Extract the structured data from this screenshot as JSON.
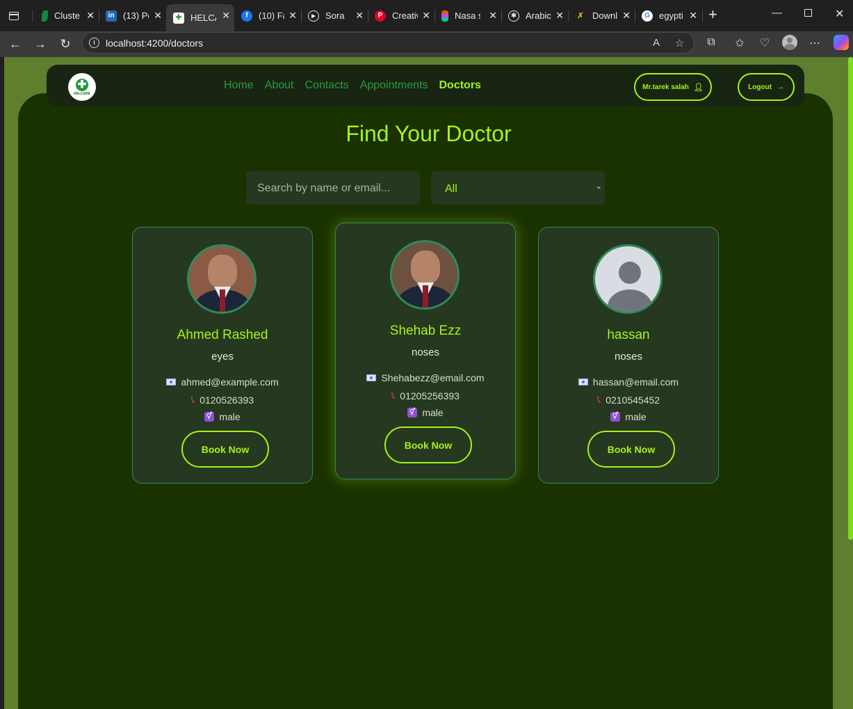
{
  "browser": {
    "tabs": [
      {
        "title": "Cluster",
        "favicon": "mongodb-leaf-icon",
        "color": "#0f8a3c"
      },
      {
        "title": "(13) Po",
        "favicon": "linkedin-icon",
        "color": "#2867b2"
      },
      {
        "title": "HELCA",
        "favicon": "helcare-icon",
        "color": "#ffffff",
        "active": true
      },
      {
        "title": "(10) Fa",
        "favicon": "facebook-icon",
        "color": "#1877f2"
      },
      {
        "title": "Sora",
        "favicon": "sora-icon",
        "color": "#202020"
      },
      {
        "title": "Creativ",
        "favicon": "pinterest-icon",
        "color": "#e60023"
      },
      {
        "title": "Nasa s",
        "favicon": "figma-icon",
        "color": "#f24e1e"
      },
      {
        "title": "Arabic",
        "favicon": "openai-icon",
        "color": "#202020"
      },
      {
        "title": "Downl",
        "favicon": "download-site-icon",
        "color": "#2a2a2a"
      },
      {
        "title": "egypti",
        "favicon": "google-icon",
        "color": "#ffffff"
      }
    ],
    "url": "localhost:4200/doctors"
  },
  "navbar": {
    "logo_text": "HELCARE",
    "links": [
      {
        "label": "Home",
        "active": false
      },
      {
        "label": "About",
        "active": false
      },
      {
        "label": "Contacts",
        "active": false
      },
      {
        "label": "Appointments",
        "active": false
      },
      {
        "label": "Doctors",
        "active": true
      }
    ],
    "user_label": "Mr.tarek salah",
    "logout_label": "Logout"
  },
  "page": {
    "title": "Find Your Doctor",
    "search_placeholder": "Search by name or email...",
    "filter_value": "All"
  },
  "doctors": [
    {
      "name": "Ahmed Rashed",
      "specialty": "eyes",
      "email": "ahmed@example.com",
      "phone": "0120526393",
      "gender": "male",
      "photo": "photo",
      "button": "Book Now"
    },
    {
      "name": "Shehab Ezz",
      "specialty": "noses",
      "email": "Shehabezz@email.com",
      "phone": "01205256393",
      "gender": "male",
      "photo": "photo",
      "button": "Book Now"
    },
    {
      "name": "hassan",
      "specialty": "noses",
      "email": "hassan@email.com",
      "phone": "0210545452",
      "gender": "male",
      "photo": "placeholder",
      "button": "Book Now"
    }
  ],
  "colors": {
    "accent": "#a6f31d",
    "panel": "#1a3200",
    "card": "#26381f",
    "border": "#2f8a5a",
    "nav_link": "#2e9a3f"
  }
}
